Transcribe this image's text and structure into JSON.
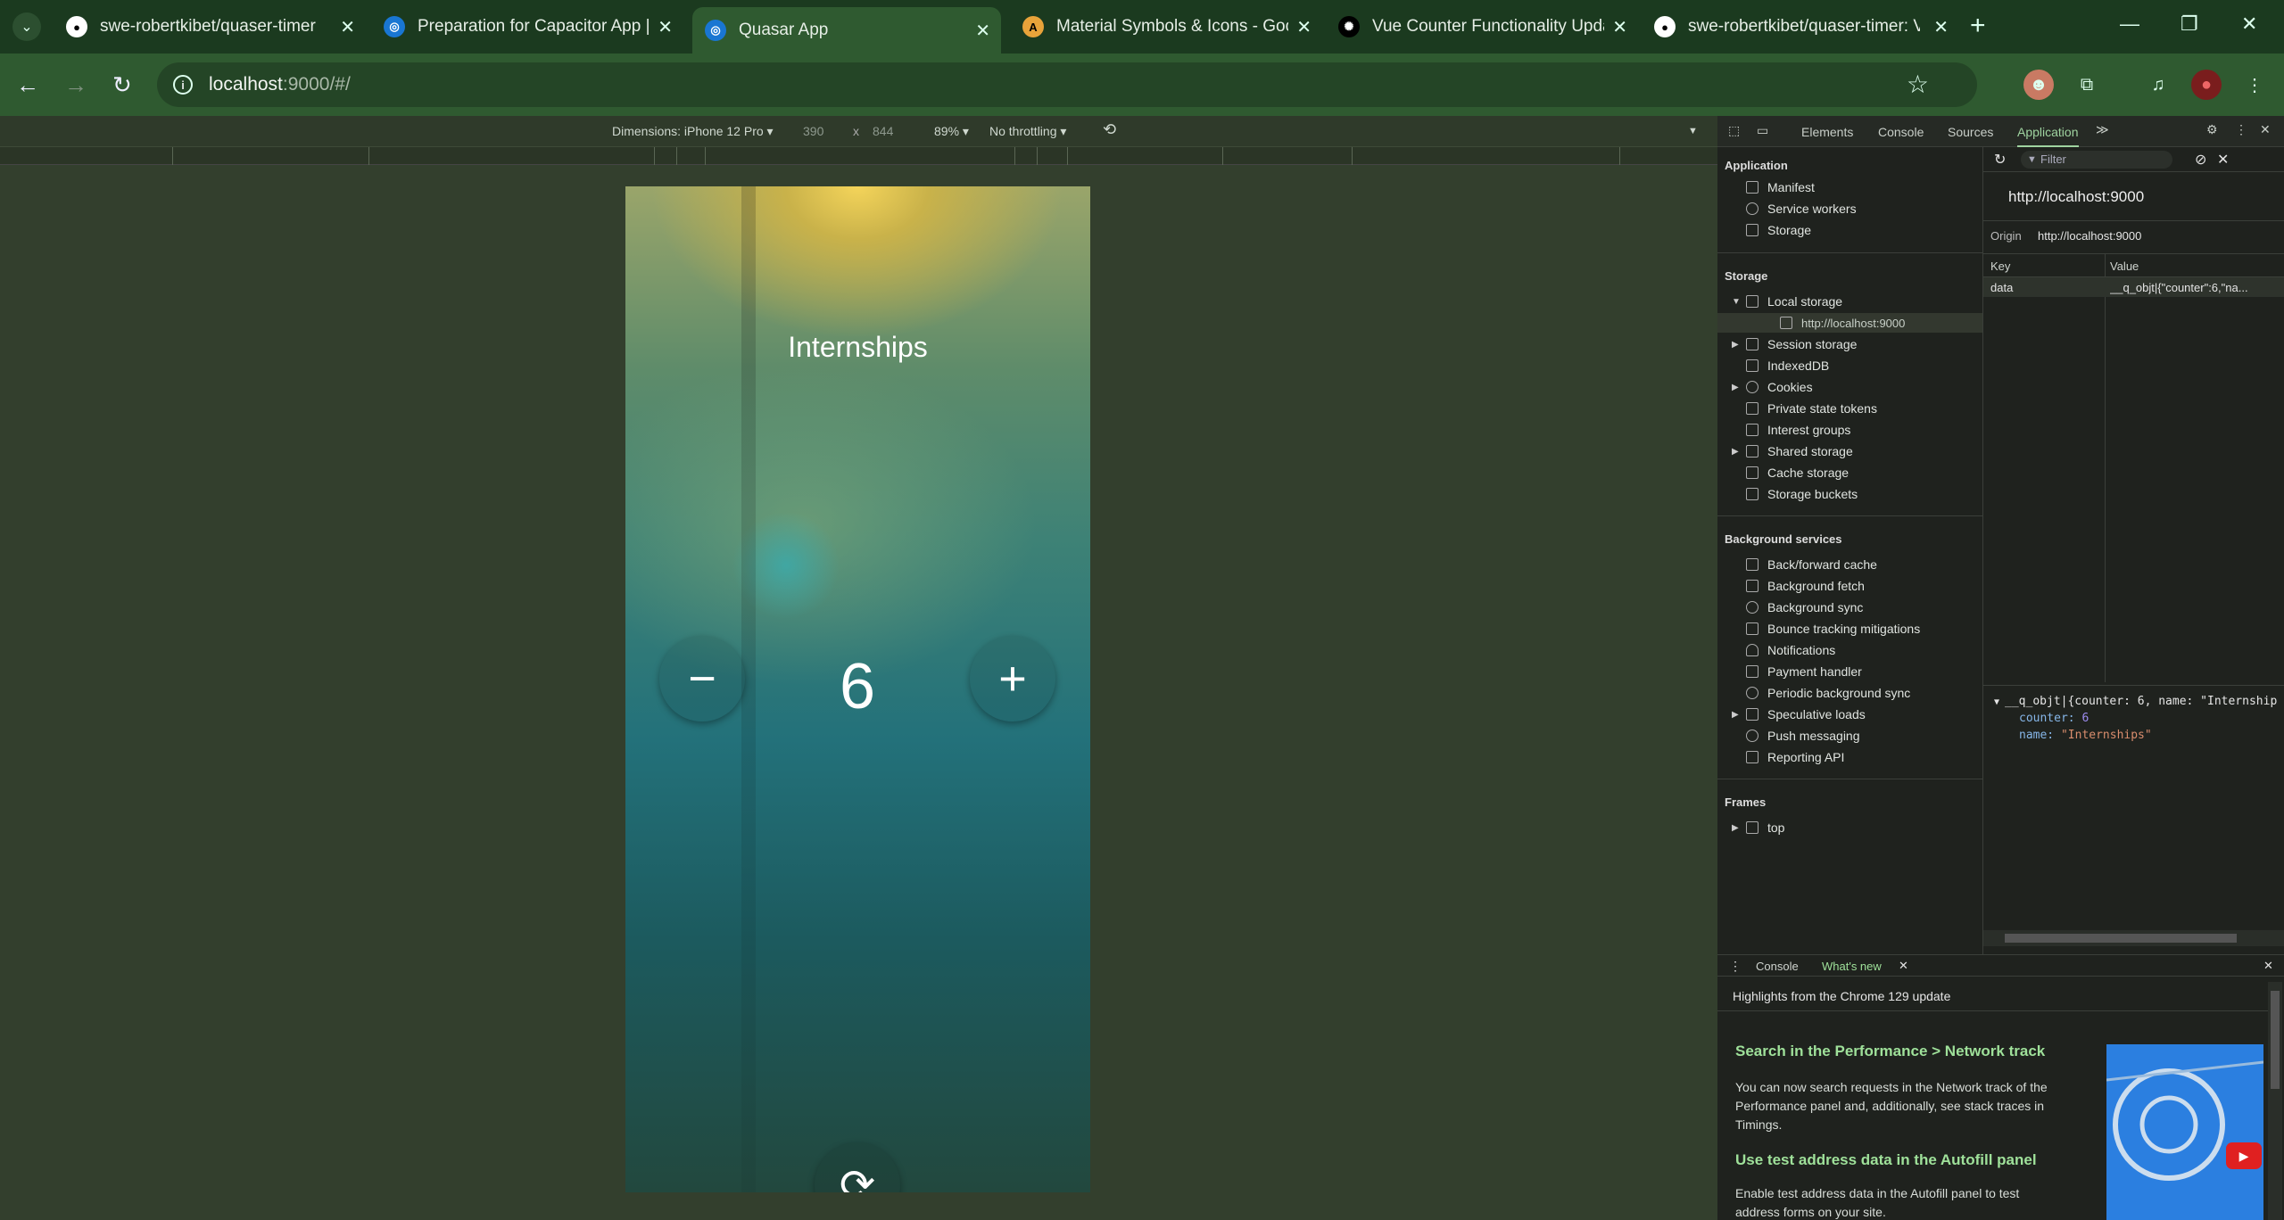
{
  "browser": {
    "tabs": [
      {
        "label": "swe-robertkibet/quaser-timer",
        "icon": "github-icon"
      },
      {
        "label": "Preparation for Capacitor App |",
        "icon": "quasar-icon"
      },
      {
        "label": "Quasar App",
        "icon": "quasar-icon"
      },
      {
        "label": "Material Symbols & Icons - Goo",
        "icon": "google-fonts-icon"
      },
      {
        "label": "Vue Counter Functionality Upda",
        "icon": "openai-icon"
      },
      {
        "label": "swe-robertkibet/quaser-timer: V",
        "icon": "github-icon"
      }
    ],
    "url_host": "localhost",
    "url_rest": ":9000/#/"
  },
  "device_toolbar": {
    "dimensions_label": "Dimensions: iPhone 12 Pro ▾",
    "width": "390",
    "x": "x",
    "height": "844",
    "zoom": "89% ▾",
    "throttle": "No throttling ▾"
  },
  "app": {
    "title": "Internships",
    "counter": "6",
    "minus": "−",
    "plus": "+"
  },
  "devtools": {
    "tabs": [
      "Elements",
      "Console",
      "Sources",
      "Application"
    ],
    "active_tab": "Application",
    "sidebar": {
      "application_header": "Application",
      "application_items": [
        "Manifest",
        "Service workers",
        "Storage"
      ],
      "storage_header": "Storage",
      "storage_items": [
        "Local storage",
        "http://localhost:9000",
        "Session storage",
        "IndexedDB",
        "Cookies",
        "Private state tokens",
        "Interest groups",
        "Shared storage",
        "Cache storage",
        "Storage buckets"
      ],
      "bg_header": "Background services",
      "bg_items": [
        "Back/forward cache",
        "Background fetch",
        "Background sync",
        "Bounce tracking mitigations",
        "Notifications",
        "Payment handler",
        "Periodic background sync",
        "Speculative loads",
        "Push messaging",
        "Reporting API"
      ],
      "frames_header": "Frames",
      "frames_items": [
        "top"
      ]
    },
    "main": {
      "filter_placeholder": "Filter",
      "origin_title": "http://localhost:9000",
      "origin_label": "Origin",
      "origin_value": "http://localhost:9000",
      "col_key": "Key",
      "col_value": "Value",
      "rows": [
        {
          "key": "data",
          "value": "__q_objt|{\"counter\":6,\"na..."
        }
      ],
      "preview_line": "__q_objt|{counter: 6, name: \"Internship",
      "preview_counter_key": "counter:",
      "preview_counter_val": "6",
      "preview_name_key": "name:",
      "preview_name_val": "\"Internships\""
    },
    "drawer": {
      "tabs": [
        "Console",
        "What's new"
      ],
      "highlight": "Highlights from the Chrome 129 update",
      "h1": "Search in the Performance > Network track",
      "p1": "You can now search requests in the Network track of the Performance panel and, additionally, see stack traces in Timings.",
      "h2": "Use test address data in the Autofill panel",
      "p2": "Enable test address data in the Autofill panel to test address forms on your site."
    }
  }
}
